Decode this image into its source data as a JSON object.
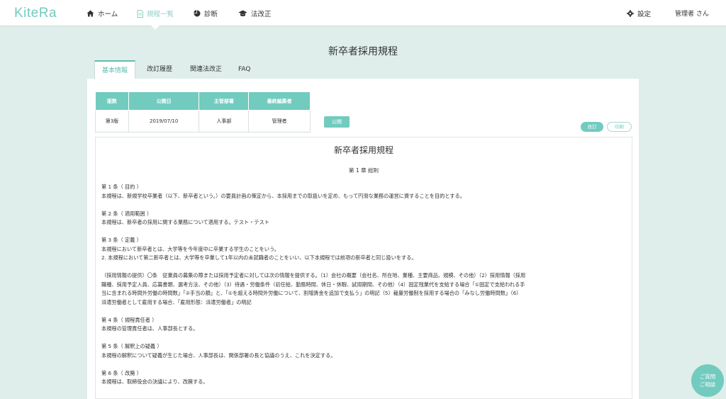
{
  "app": {
    "logo": "KiteRa"
  },
  "nav": {
    "items": [
      {
        "label": "ホーム",
        "icon": "home-icon"
      },
      {
        "label": "規程一覧",
        "icon": "document-icon"
      },
      {
        "label": "診断",
        "icon": "pie-chart-icon"
      },
      {
        "label": "法改正",
        "icon": "graduation-cap-icon"
      }
    ],
    "active_index": 1,
    "settings_label": "設定",
    "user_label": "管理者 さん"
  },
  "page": {
    "title": "新卒者採用規程"
  },
  "tabs": [
    {
      "label": "基本情報",
      "active": true
    },
    {
      "label": "改訂履歴",
      "active": false
    },
    {
      "label": "関連法改正",
      "active": false
    },
    {
      "label": "FAQ",
      "active": false
    }
  ],
  "info_table": {
    "headers": [
      "版数",
      "公開日",
      "主管部署",
      "最終編集者"
    ],
    "row": [
      "第3版",
      "2019/07/10",
      "人事部",
      "管理者"
    ]
  },
  "buttons": {
    "publish": "公開",
    "revise": "改訂",
    "print": "印刷"
  },
  "document": {
    "title": "新卒者採用規程",
    "chapter": "第 1 章 総則",
    "articles": [
      {
        "lines": [
          "第 1 条（ 目的 ）",
          "本規程は、新規学校卒業者（以下、新卒者という。）の要員計画の策定から、本採用までの取扱いを定め、もって円滑な業務の運営に資することを目的とする。"
        ]
      },
      {
        "lines": [
          "第 2 条（ 適用範囲 ）",
          "本規程は、新卒者の採用に関する業務について適用する。テスト・テスト"
        ]
      },
      {
        "lines": [
          "第 3 条（ 定義 ）",
          "本規程において新卒者とは、大学等を今年度中に卒業する学生のことをいう。",
          "2. 本規程において第二新卒者とは、大学等を卒業して1年以内の未就職者のことをいい、以下本規程では前項の新卒者と同じ扱いをする。"
        ]
      },
      {
        "lines": [
          "（採用情報の提供）〇条　従業員の募集の際または採用予定者に対しては次の情報を提供する。（1）会社の概要（会社名、所在地、業種、主要商品、規模、その他）（2）採用情報（採用",
          "職種、採用予定人員、応募書類、選考方法、その他）（3）待遇・労働条件（初任給、勤務時間、休日・休暇、試用期間、その他）（4）固定残業代を支給する場合「①固定で支給われる手",
          "当に含まれる時間外労働の時間数」「②手当の額」と、「①を超える時間外労働について、割増賃金を追加で支払う」の明記（5）裁量労働制を採用する場合の「みなし労働時間数」（6）",
          "派遣労働者として雇用する場合、「雇用形態：派遣労働者」の明記"
        ]
      },
      {
        "lines": [
          "第 4 条（ 規程責任者 ）",
          "本規程の管理責任者は、人事部長とする。"
        ]
      },
      {
        "lines": [
          "第 5 条（ 解釈上の疑義 ）",
          "本規程の解釈について疑義が生じた場合、人事部長は、関係部署の長と協議のうえ、これを決定する。"
        ]
      },
      {
        "lines": [
          "第 6 条（ 改廃 ）",
          "本規程は、取締役会の決議により、改廃する。"
        ]
      }
    ]
  },
  "chat": {
    "line1": "ご質問",
    "line2": "ご相談"
  },
  "colors": {
    "accent": "#72cbbf",
    "background": "#dfeeea"
  }
}
